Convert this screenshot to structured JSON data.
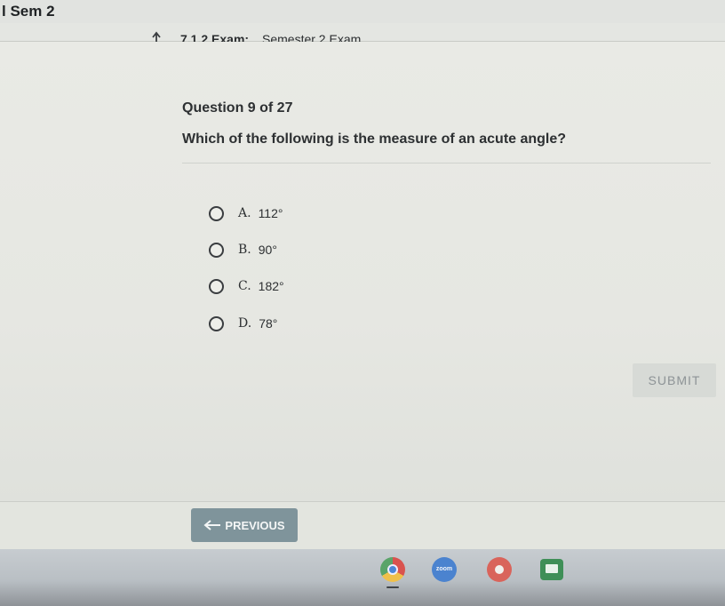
{
  "header": {
    "course_title": "l Sem 2",
    "exam_label": "7.1.2",
    "exam_type": "Exam:",
    "exam_name": "Semester 2 Exam"
  },
  "question": {
    "number_text": "Question 9 of 27",
    "text": "Which of the following is the measure of an acute angle?",
    "options": [
      {
        "letter": "A.",
        "value": "112°"
      },
      {
        "letter": "B.",
        "value": "90°"
      },
      {
        "letter": "C.",
        "value": "182°"
      },
      {
        "letter": "D.",
        "value": "78°"
      }
    ]
  },
  "buttons": {
    "submit_label": "SUBMIT",
    "previous_label": "PREVIOUS"
  },
  "shelf": {
    "zoom_label": "zoom",
    "icons": [
      "chrome-icon",
      "zoom-icon",
      "photos-icon",
      "screen-icon"
    ]
  },
  "colors": {
    "previous_button": "#7f949b",
    "submit_disabled": "#d7dad6"
  }
}
